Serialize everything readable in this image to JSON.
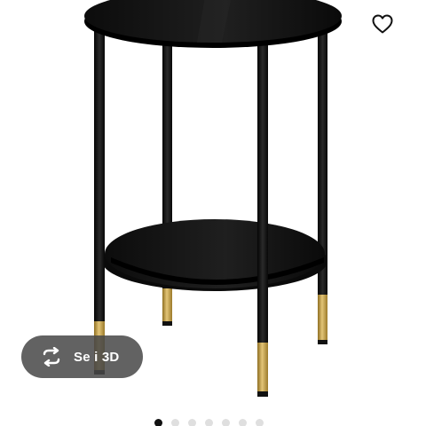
{
  "product_image": {
    "alt": ""
  },
  "favourite": {
    "icon": "heart-icon"
  },
  "view_3d": {
    "label": "Se i 3D",
    "icon": "rotate-3d-icon"
  },
  "carousel": {
    "dot_count": 7,
    "active_index": 0
  },
  "colors": {
    "table_black": "#111111",
    "brass": "#c9a84a",
    "pill_background": "#484848",
    "dot_active": "#111111",
    "dot_inactive": "#dfdfdf"
  }
}
